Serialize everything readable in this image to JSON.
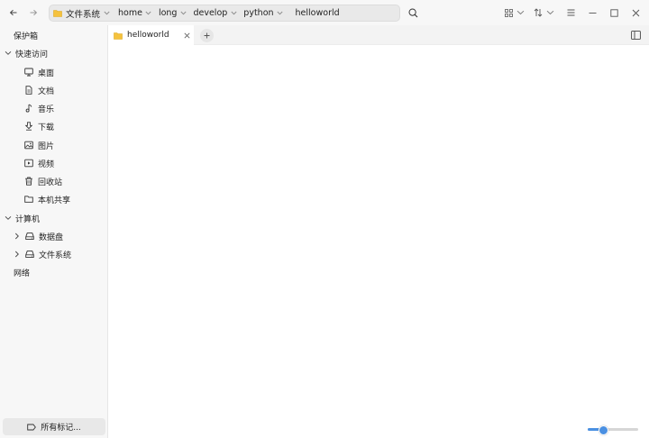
{
  "breadcrumb": {
    "items": [
      {
        "label": "文件系统"
      },
      {
        "label": "home"
      },
      {
        "label": "long"
      },
      {
        "label": "develop"
      },
      {
        "label": "python"
      },
      {
        "label": "helloworld"
      }
    ]
  },
  "sidebar": {
    "sections": {
      "vault": "保护箱",
      "quick_access": "快速访问",
      "computer": "计算机",
      "network": "网络"
    },
    "quick_items": [
      {
        "label": "桌面",
        "icon": "monitor-icon"
      },
      {
        "label": "文档",
        "icon": "document-icon"
      },
      {
        "label": "音乐",
        "icon": "music-icon"
      },
      {
        "label": "下载",
        "icon": "download-icon"
      },
      {
        "label": "图片",
        "icon": "image-icon"
      },
      {
        "label": "视频",
        "icon": "video-icon"
      },
      {
        "label": "回收站",
        "icon": "trash-icon"
      },
      {
        "label": "本机共享",
        "icon": "folder-icon"
      }
    ],
    "computer_items": [
      {
        "label": "数据盘",
        "icon": "drive-icon"
      },
      {
        "label": "文件系统",
        "icon": "drive-icon"
      }
    ],
    "tags_button": "所有标记..."
  },
  "tabs": [
    {
      "label": "helloworld",
      "active": true
    }
  ],
  "status": {
    "zoom_fraction": 0.3
  },
  "colors": {
    "folder": "#f5c23e",
    "accent": "#4a90e2"
  }
}
